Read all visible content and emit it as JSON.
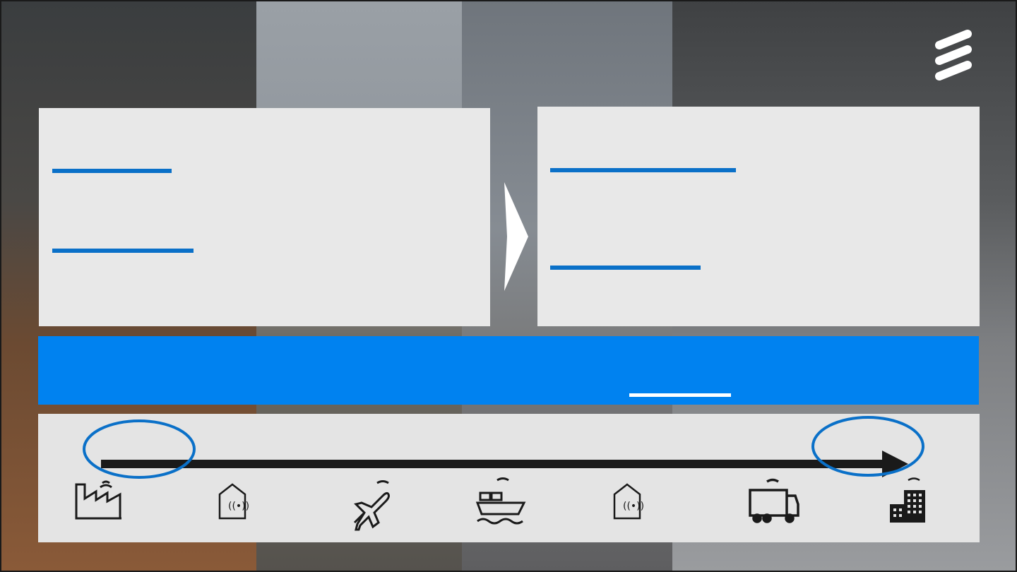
{
  "slide": {
    "background_photos": [
      "port-cranes",
      "building",
      "train-station",
      "airport-hangar"
    ],
    "accent_color": "#0082f0",
    "underline_color": "#0a70c8"
  },
  "logo": {
    "icon": "ericsson-logo-icon",
    "color": "#ffffff"
  },
  "left_panel": {
    "underlines": 2
  },
  "right_panel": {
    "underlines": 2
  },
  "banner": {
    "color": "#0082f0"
  },
  "timeline": {
    "icons": [
      "factory-icon",
      "warehouse-icon",
      "airplane-icon",
      "ship-icon",
      "warehouse-icon",
      "truck-icon",
      "building-icon"
    ],
    "highlight_color": "#0a70c8"
  }
}
